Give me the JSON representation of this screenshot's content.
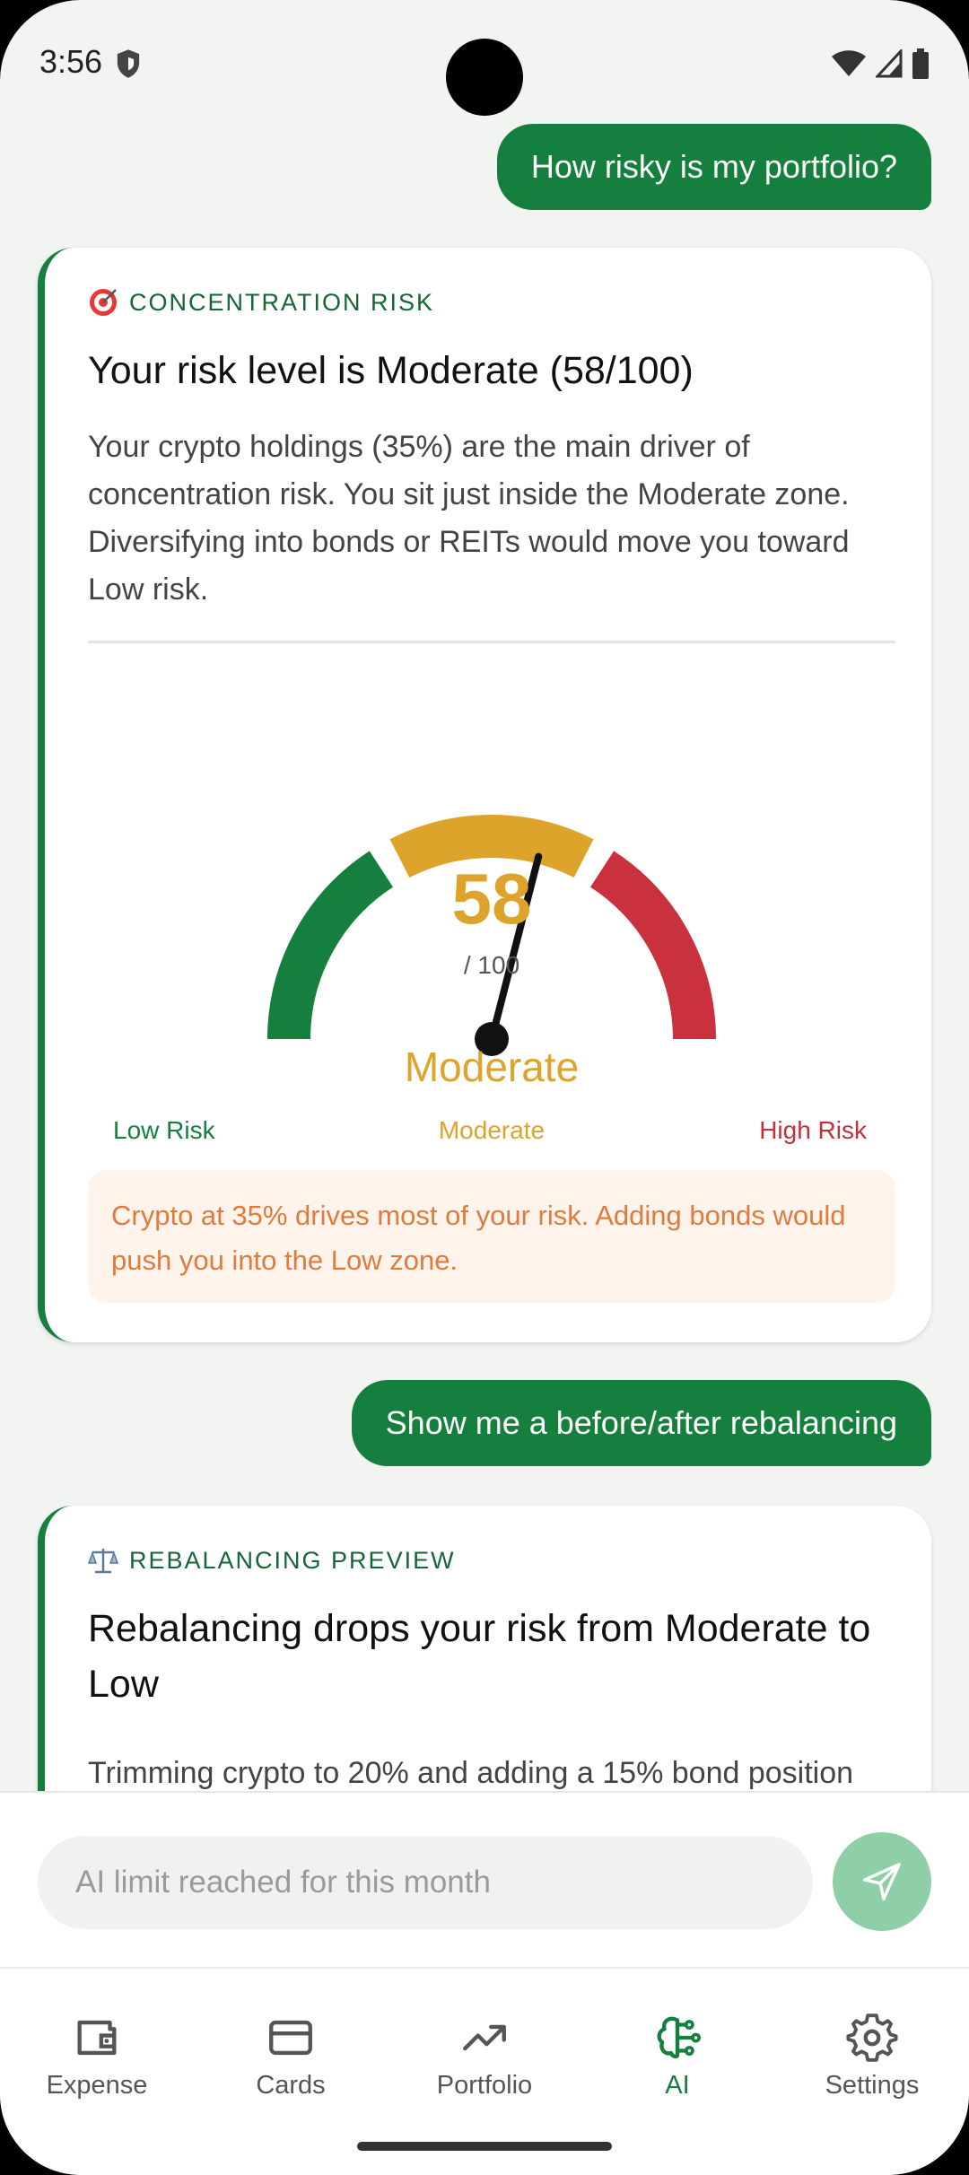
{
  "status_bar": {
    "time": "3:56",
    "icons": [
      "shield-icon",
      "wifi-icon",
      "signal-icon",
      "battery-icon"
    ]
  },
  "messages": {
    "user_1": "How risky is my portfolio?",
    "user_2": "Show me a before/after rebalancing"
  },
  "risk_card": {
    "tag_icon": "target-icon",
    "tag": "CONCENTRATION RISK",
    "title": "Your risk level is Moderate (58/100)",
    "body": "Your crypto holdings (35%) are the main driver of concentration risk. You sit just inside the Moderate zone. Diversifying into bonds or REITs would move you toward Low risk.",
    "gauge": {
      "value": "58",
      "max": "/ 100",
      "score": 58,
      "label": "Moderate",
      "scale_low": "Low Risk",
      "scale_mid": "Moderate",
      "scale_high": "High Risk",
      "colors": {
        "low": "#15803d",
        "mid": "#dea32a",
        "high": "#c9323d"
      }
    },
    "note": "Crypto at 35% drives most of your risk. Adding bonds would push you into the Low zone."
  },
  "rebalance_card": {
    "tag_icon": "scales-icon",
    "tag": "REBALANCING PREVIEW",
    "title": "Rebalancing drops your risk from Moderate to Low",
    "body": "Trimming crypto to 20% and adding a 15% bond position"
  },
  "input": {
    "placeholder": "AI limit reached for this month"
  },
  "nav": {
    "expense": "Expense",
    "cards": "Cards",
    "portfolio": "Portfolio",
    "ai": "AI",
    "settings": "Settings",
    "active": "ai"
  },
  "colors": {
    "accent": "#15803d",
    "send_disabled": "#8fcfa8"
  }
}
